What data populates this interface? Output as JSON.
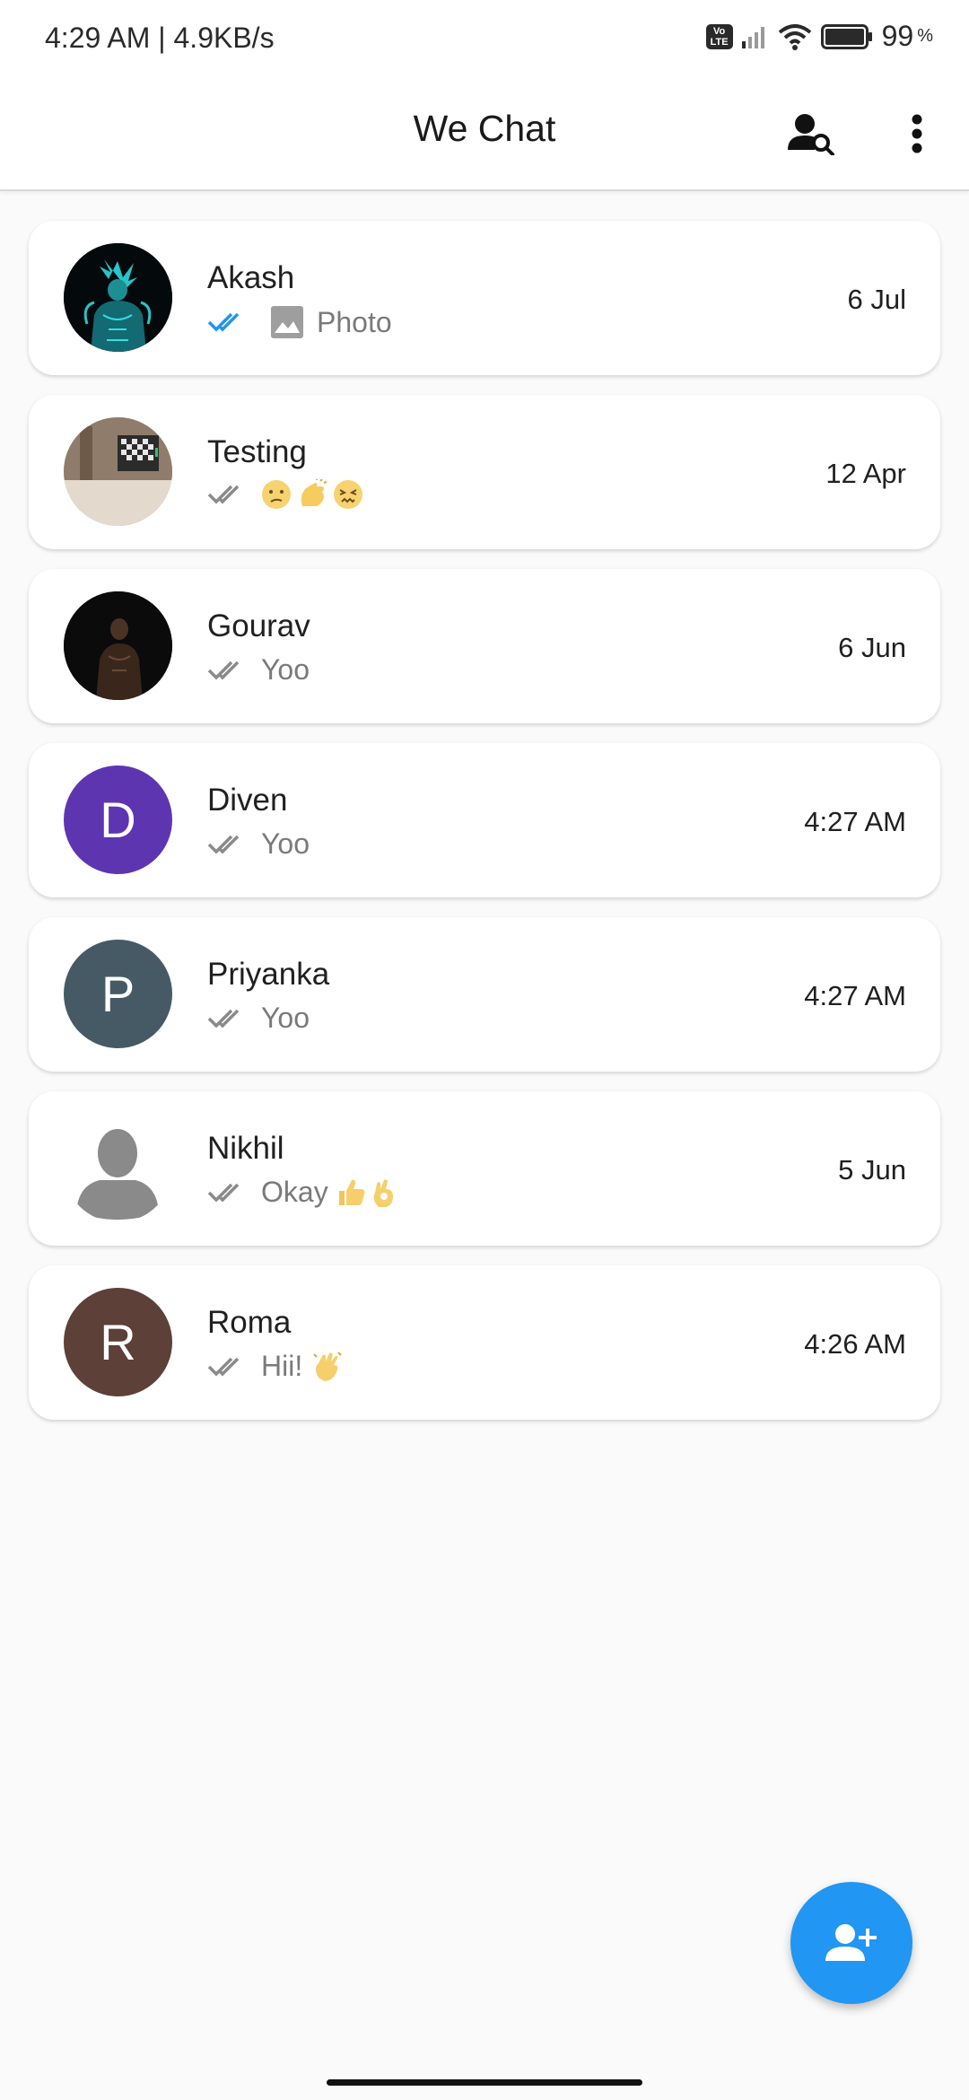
{
  "status_bar": {
    "time_speed": "4:29 AM | 4.9KB/s",
    "volte": "Vo LTE",
    "battery": "99",
    "battery_unit": "%"
  },
  "app_bar": {
    "title": "We Chat",
    "search_icon": "person-search-icon",
    "menu_icon": "more-vert-icon"
  },
  "chats": [
    {
      "name": "Akash",
      "preview": "Photo",
      "time": "6 Jul",
      "read": true,
      "avatar_type": "photo",
      "preview_icon": "image-icon"
    },
    {
      "name": "Testing",
      "preview": "",
      "time": "12 Apr",
      "read": false,
      "avatar_type": "photo",
      "emojis": [
        "confused-face",
        "clapping-hands",
        "persevering-face"
      ]
    },
    {
      "name": "Gourav",
      "preview": "Yoo",
      "time": "6 Jun",
      "read": false,
      "avatar_type": "photo"
    },
    {
      "name": "Diven",
      "preview": "Yoo",
      "time": "4:27 AM",
      "read": false,
      "avatar_type": "letter",
      "initial": "D",
      "color": "#5e35b1"
    },
    {
      "name": "Priyanka",
      "preview": "Yoo",
      "time": "4:27 AM",
      "read": false,
      "avatar_type": "letter",
      "initial": "P",
      "color": "#455a64"
    },
    {
      "name": "Nikhil",
      "preview": "Okay",
      "time": "5 Jun",
      "read": false,
      "avatar_type": "placeholder",
      "emojis": [
        "thumbs-up",
        "ok-hand"
      ]
    },
    {
      "name": "Roma",
      "preview": "Hii!",
      "time": "4:26 AM",
      "read": false,
      "avatar_type": "letter",
      "initial": "R",
      "color": "#5d4037",
      "emojis": [
        "waving-hand"
      ]
    }
  ],
  "fab": {
    "icon": "add-person-icon",
    "color": "#2196f3"
  },
  "colors": {
    "read_tick": "#2196f3",
    "unread_tick": "#8a8a8a"
  }
}
